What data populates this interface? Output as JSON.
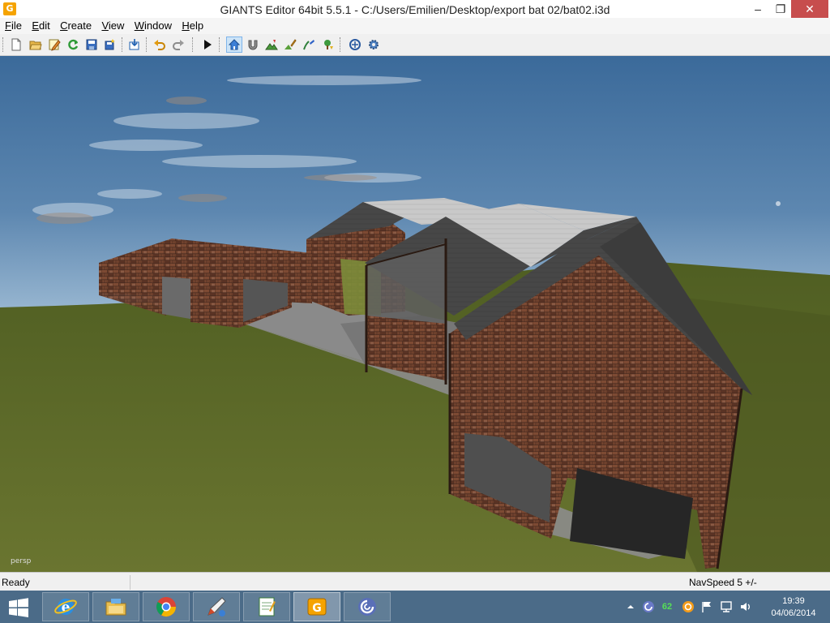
{
  "window": {
    "title": "GIANTS Editor 64bit 5.5.1 - C:/Users/Emilien/Desktop/export bat 02/bat02.i3d",
    "controls": {
      "minimize": "–",
      "maximize": "❐",
      "close": "✕"
    }
  },
  "menu": {
    "items": [
      {
        "label": "File",
        "accel": "F"
      },
      {
        "label": "Edit",
        "accel": "E"
      },
      {
        "label": "Create",
        "accel": "C"
      },
      {
        "label": "View",
        "accel": "V"
      },
      {
        "label": "Window",
        "accel": "W"
      },
      {
        "label": "Help",
        "accel": "H"
      }
    ]
  },
  "toolbar": {
    "buttons": [
      "new-file-icon",
      "open-folder-icon",
      "edit-script-icon",
      "refresh-icon",
      "save-icon",
      "save-as-icon",
      "import-icon",
      "undo-icon",
      "redo-icon",
      "play-icon",
      "home-camera-icon",
      "magnet-icon",
      "terrain-sculpt-icon",
      "terrain-paint-icon",
      "foliage-paint-icon",
      "place-object-icon",
      "gizmo-rotate-icon",
      "settings-gear-icon"
    ],
    "active": "home-camera-icon"
  },
  "viewport": {
    "camera_label": "persp",
    "colors": {
      "sky_top": "#3f6d9c",
      "sky_bottom": "#8fb0cc",
      "grass": "#5b6a2a",
      "brick": "#6a3f2c",
      "roof_light": "#cfcfcf",
      "roof_dark": "#4a4a4a",
      "concrete": "#8a8a8a"
    }
  },
  "status": {
    "left": "Ready",
    "right": "NavSpeed 5 +/-"
  },
  "taskbar": {
    "apps": [
      "internet-explorer-icon",
      "file-explorer-icon",
      "chrome-icon",
      "paint-icon",
      "notepad-icon",
      "giants-editor-icon",
      "bittorrent-icon"
    ],
    "active_app": "giants-editor-icon",
    "tray_number": "62",
    "clock_time": "19:39",
    "clock_date": "04/06/2014"
  }
}
